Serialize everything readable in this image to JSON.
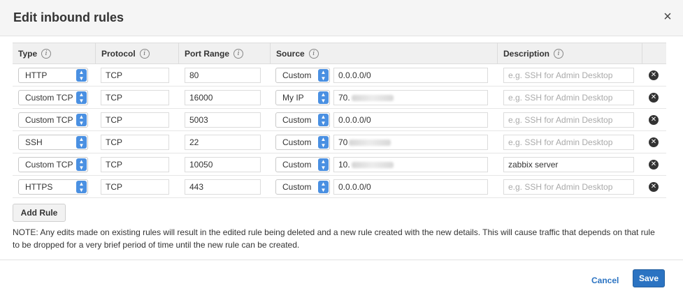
{
  "dialog": {
    "title": "Edit inbound rules",
    "close_glyph": "×"
  },
  "columns": {
    "type": "Type",
    "protocol": "Protocol",
    "port_range": "Port Range",
    "source": "Source",
    "description": "Description",
    "info_glyph": "i"
  },
  "rows": [
    {
      "type": "HTTP",
      "protocol": "TCP",
      "port": "80",
      "source_type": "Custom",
      "source_value": "0.0.0.0/0",
      "source_redacted": false,
      "description": "",
      "description_placeholder": "e.g. SSH for Admin Desktop"
    },
    {
      "type": "Custom TCP",
      "protocol": "TCP",
      "port": "16000",
      "source_type": "My IP",
      "source_value": "70.",
      "source_redacted": true,
      "description": "",
      "description_placeholder": "e.g. SSH for Admin Desktop"
    },
    {
      "type": "Custom TCP",
      "protocol": "TCP",
      "port": "5003",
      "source_type": "Custom",
      "source_value": "0.0.0.0/0",
      "source_redacted": false,
      "description": "",
      "description_placeholder": "e.g. SSH for Admin Desktop"
    },
    {
      "type": "SSH",
      "protocol": "TCP",
      "port": "22",
      "source_type": "Custom",
      "source_value": "70",
      "source_redacted": true,
      "description": "",
      "description_placeholder": "e.g. SSH for Admin Desktop"
    },
    {
      "type": "Custom TCP",
      "protocol": "TCP",
      "port": "10050",
      "source_type": "Custom",
      "source_value": "10.",
      "source_redacted": true,
      "description": "zabbix server",
      "description_placeholder": "e.g. SSH for Admin Desktop"
    },
    {
      "type": "HTTPS",
      "protocol": "TCP",
      "port": "443",
      "source_type": "Custom",
      "source_value": "0.0.0.0/0",
      "source_redacted": false,
      "description": "",
      "description_placeholder": "e.g. SSH for Admin Desktop"
    }
  ],
  "actions": {
    "add_rule": "Add Rule",
    "cancel": "Cancel",
    "save": "Save",
    "remove_glyph": "✕"
  },
  "note": "NOTE: Any edits made on existing rules will result in the edited rule being deleted and a new rule created with the new details. This will cause traffic that depends on that rule to be dropped for a very brief period of time until the new rule can be created.",
  "icons": {
    "select_arrow_up": "▲",
    "select_arrow_down": "▼"
  },
  "colors": {
    "accent": "#2b73c2",
    "select_arrow": "#4a90e2",
    "header_bg": "#f5f5f5"
  }
}
